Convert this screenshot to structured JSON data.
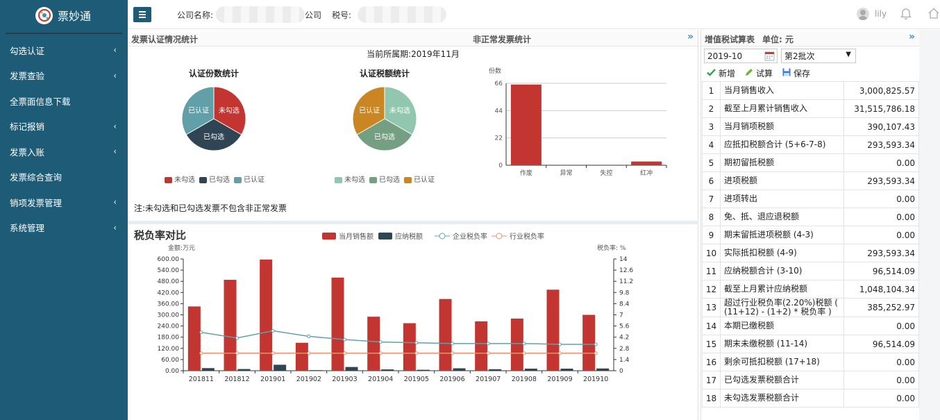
{
  "app": {
    "name": "票妙通"
  },
  "sidebar": {
    "items": [
      {
        "label": "勾选认证",
        "chevron": "‹"
      },
      {
        "label": "发票查验",
        "chevron": "‹"
      },
      {
        "label": "全票面信息下载",
        "chevron": ""
      },
      {
        "label": "标记报销",
        "chevron": "‹"
      },
      {
        "label": "发票入账",
        "chevron": "‹"
      },
      {
        "label": "发票综合查询",
        "chevron": ""
      },
      {
        "label": "销项发票管理",
        "chevron": "‹"
      },
      {
        "label": "系统管理",
        "chevron": "‹"
      }
    ]
  },
  "header": {
    "company_label": "公司名称:",
    "company_suffix": "公司",
    "tax_label": "税号:",
    "user": "lily"
  },
  "invoice_panel": {
    "title": "发票认证情况统计",
    "abnormal_title": "非正常发票统计",
    "period": "当前所属期:2019年11月",
    "note": "注:未勾选和已勾选发票不包含非正常发票",
    "pie1": {
      "title": "认证份数统计",
      "slices": [
        {
          "label": "未勾选",
          "value": 1,
          "color": "#c23531"
        },
        {
          "label": "已勾选",
          "value": 1,
          "color": "#2f4554"
        },
        {
          "label": "已认证",
          "value": 1,
          "color": "#61a0a8"
        }
      ]
    },
    "pie2": {
      "title": "认证税额统计",
      "slices": [
        {
          "label": "未勾选",
          "value": 1,
          "color": "#91c7ae"
        },
        {
          "label": "已勾选",
          "value": 1,
          "color": "#749f83"
        },
        {
          "label": "已认证",
          "value": 1,
          "color": "#ca8622"
        }
      ]
    }
  },
  "chart_data": [
    {
      "type": "pie",
      "title": "认证份数统计",
      "categories": [
        "未勾选",
        "已勾选",
        "已认证"
      ],
      "values": [
        1,
        1,
        1
      ]
    },
    {
      "type": "pie",
      "title": "认证税额统计",
      "categories": [
        "未勾选",
        "已勾选",
        "已认证"
      ],
      "values": [
        1,
        1,
        1
      ]
    },
    {
      "type": "bar",
      "ylabel": "份数",
      "categories": [
        "作废",
        "异常",
        "失控",
        "红冲"
      ],
      "values": [
        65,
        0,
        0,
        3
      ],
      "yticks": [
        0,
        22,
        44,
        66
      ],
      "ylim": [
        0,
        66
      ],
      "color": "#c23531"
    },
    {
      "type": "bar",
      "title": "税负率对比",
      "categories": [
        "201811",
        "201812",
        "201901",
        "201902",
        "201903",
        "201904",
        "201905",
        "201906",
        "201907",
        "201908",
        "201909",
        "201910"
      ],
      "ylabel": "金额:万元",
      "ylabel_right": "税负率: %",
      "yticks": [
        "0.00",
        "60.00",
        "120.00",
        "180.00",
        "240.00",
        "300.00",
        "360.00",
        "420.00",
        "480.00",
        "540.00",
        "600.00"
      ],
      "yticks_right": [
        "0",
        "1.4",
        "2.8",
        "4.2",
        "5.6",
        "7",
        "8.4",
        "9.8",
        "11.2",
        "12.6",
        "14"
      ],
      "ylim": [
        0,
        600
      ],
      "ylim_right": [
        0,
        14
      ],
      "series": [
        {
          "name": "当月销售额",
          "type": "bar",
          "axis": "left",
          "color": "#c23531",
          "values": [
            345,
            488,
            597,
            150,
            500,
            290,
            255,
            385,
            265,
            280,
            435,
            300
          ]
        },
        {
          "name": "应纳税额",
          "type": "bar",
          "axis": "left",
          "color": "#2f4554",
          "values": [
            14,
            9,
            32,
            3,
            20,
            7,
            5,
            13,
            8,
            11,
            11,
            12
          ]
        },
        {
          "name": "企业税负率",
          "type": "line",
          "axis": "right",
          "color": "#61a0a8",
          "values": [
            4.8,
            4.1,
            5.0,
            4.3,
            3.9,
            3.6,
            3.5,
            3.4,
            3.4,
            3.4,
            3.3,
            3.3
          ]
        },
        {
          "name": "行业税负率",
          "type": "line",
          "axis": "right",
          "color": "#e98f6f",
          "values": [
            2.2,
            2.2,
            2.2,
            2.2,
            2.2,
            2.2,
            2.2,
            2.2,
            2.2,
            2.2,
            2.2,
            2.2
          ]
        }
      ]
    }
  ],
  "vat_panel": {
    "title": "增值税试算表",
    "unit": "单位: 元",
    "period": "2019-10",
    "batch": "第2批次",
    "buttons": {
      "add": "新增",
      "calc": "试算",
      "save": "保存"
    },
    "rows": [
      {
        "no": "1",
        "label": "当月销售收入",
        "value": "3,000,825.57"
      },
      {
        "no": "2",
        "label": "截至上月累计销售收入",
        "value": "31,515,786.18"
      },
      {
        "no": "3",
        "label": "当月销项税额",
        "value": "390,107.43"
      },
      {
        "no": "4",
        "label": "应抵扣税额合计 (5+6-7-8)",
        "value": "293,593.34"
      },
      {
        "no": "5",
        "label": "期初留抵税额",
        "value": "0.00"
      },
      {
        "no": "6",
        "label": "进项税额",
        "value": "293,593.34"
      },
      {
        "no": "7",
        "label": "进项转出",
        "value": "0.00"
      },
      {
        "no": "8",
        "label": "免、抵、退应退税额",
        "value": "0.00"
      },
      {
        "no": "9",
        "label": "期末留抵进项税额 (4-3)",
        "value": "0.00"
      },
      {
        "no": "10",
        "label": "实际抵扣税额 (4-9)",
        "value": "293,593.34"
      },
      {
        "no": "11",
        "label": "应纳税额合计 (3-10)",
        "value": "96,514.09"
      },
      {
        "no": "12",
        "label": "截至上月累计应纳税额",
        "value": "1,048,104.34"
      },
      {
        "no": "13",
        "label": "超过行业税负率(2.20%)税额 ( (11+12) - (1+2) * 税负率 )",
        "value": "385,252.97"
      },
      {
        "no": "14",
        "label": "本期已缴税额",
        "value": "0.00"
      },
      {
        "no": "15",
        "label": "期末未缴税额 (11-14)",
        "value": "96,514.09"
      },
      {
        "no": "16",
        "label": "剩余可抵扣税额 (17+18)",
        "value": "0.00"
      },
      {
        "no": "17",
        "label": "已勾选发票税额合计",
        "value": "0.00"
      },
      {
        "no": "18",
        "label": "未勾选发票税额合计",
        "value": "0.00"
      }
    ]
  }
}
